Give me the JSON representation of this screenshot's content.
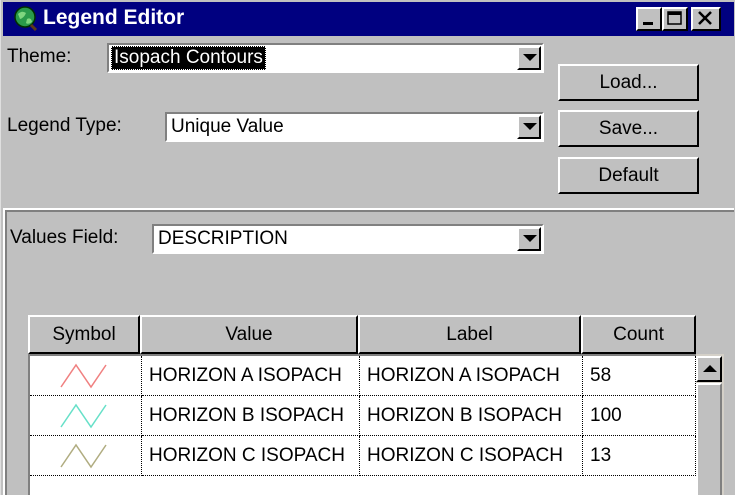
{
  "window": {
    "title": "Legend Editor",
    "icon": "globe-icon",
    "controls": [
      "minimize-icon",
      "maximize-icon",
      "close-icon"
    ]
  },
  "theme": {
    "label": "Theme:",
    "value": "Isopach Contours"
  },
  "legend_type": {
    "label": "Legend Type:",
    "value": "Unique Value"
  },
  "buttons": {
    "load": "Load...",
    "save": "Save...",
    "default": "Default"
  },
  "values_field": {
    "label": "Values Field:",
    "value": "DESCRIPTION"
  },
  "table": {
    "columns": [
      "Symbol",
      "Value",
      "Label",
      "Count"
    ],
    "rows": [
      {
        "symbol_color": "#f08080",
        "value": "HORIZON A ISOPACH",
        "label": "HORIZON A ISOPACH",
        "count": "58"
      },
      {
        "symbol_color": "#66e0c8",
        "value": "HORIZON B ISOPACH",
        "label": "HORIZON B ISOPACH",
        "count": "100"
      },
      {
        "symbol_color": "#b0ac80",
        "value": "HORIZON C ISOPACH",
        "label": "HORIZON C ISOPACH",
        "count": "13"
      }
    ]
  },
  "colors": {
    "titlebar": "#000080",
    "face": "#c0c0c0"
  }
}
